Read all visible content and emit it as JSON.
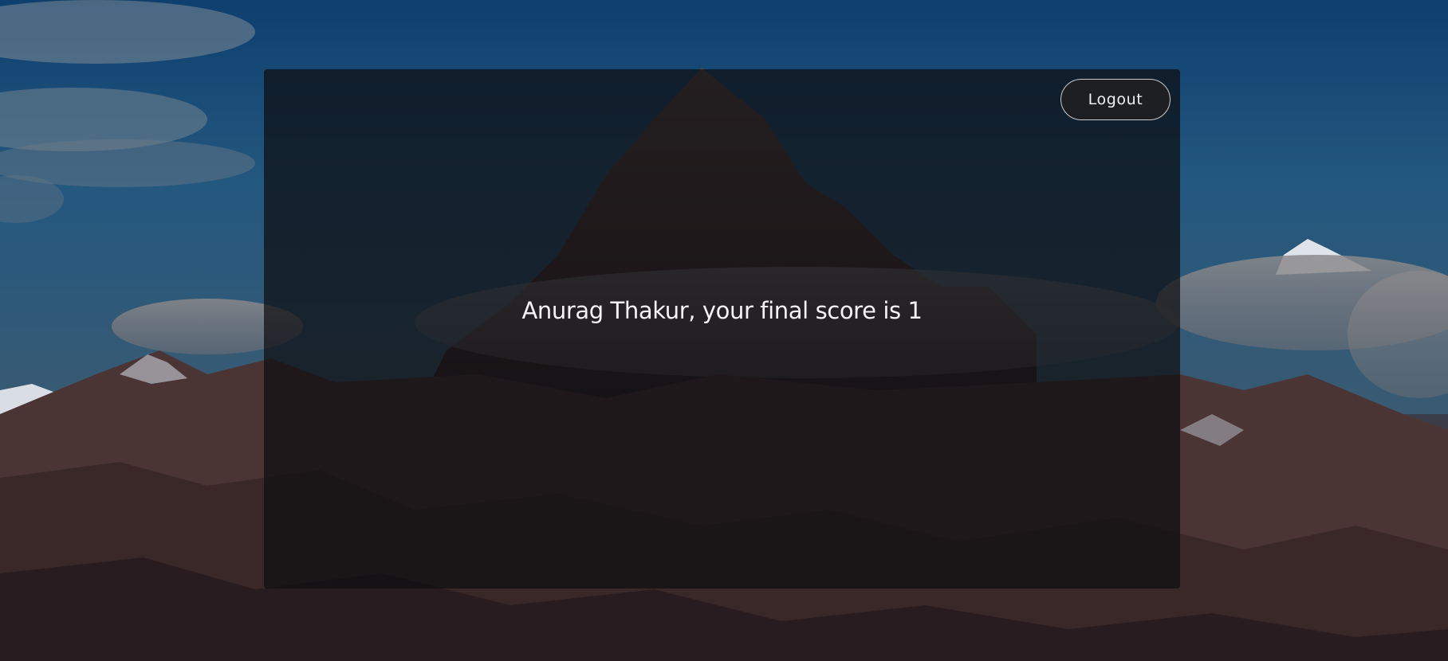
{
  "header": {
    "logout_label": "Logout"
  },
  "result": {
    "message": "Anurag Thakur, your final score is 1"
  },
  "colors": {
    "card_overlay": "rgba(14,14,16,0.72)",
    "text": "#f4f4f4",
    "button_border": "#c9c9c9"
  }
}
